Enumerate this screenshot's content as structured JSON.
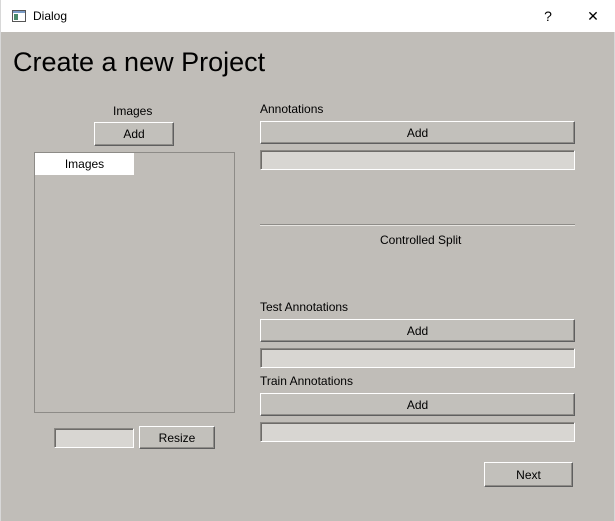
{
  "window": {
    "title": "Dialog",
    "help_label": "?",
    "close_label": "✕",
    "icon": "app-window-icon",
    "colors": {
      "background": "#c0bdb8",
      "titlebar": "#ffffff"
    }
  },
  "main": {
    "heading": "Create a new Project",
    "images": {
      "label": "Images",
      "add_label": "Add",
      "list_header": "Images",
      "resize_input_value": "",
      "resize_label": "Resize"
    },
    "annotations": {
      "label": "Annotations",
      "add_label": "Add",
      "path_value": ""
    },
    "controlled_split_label": "Controlled Split",
    "test_annotations": {
      "label": "Test Annotations",
      "add_label": "Add",
      "path_value": ""
    },
    "train_annotations": {
      "label": "Train Annotations",
      "add_label": "Add",
      "path_value": ""
    },
    "next_label": "Next"
  }
}
